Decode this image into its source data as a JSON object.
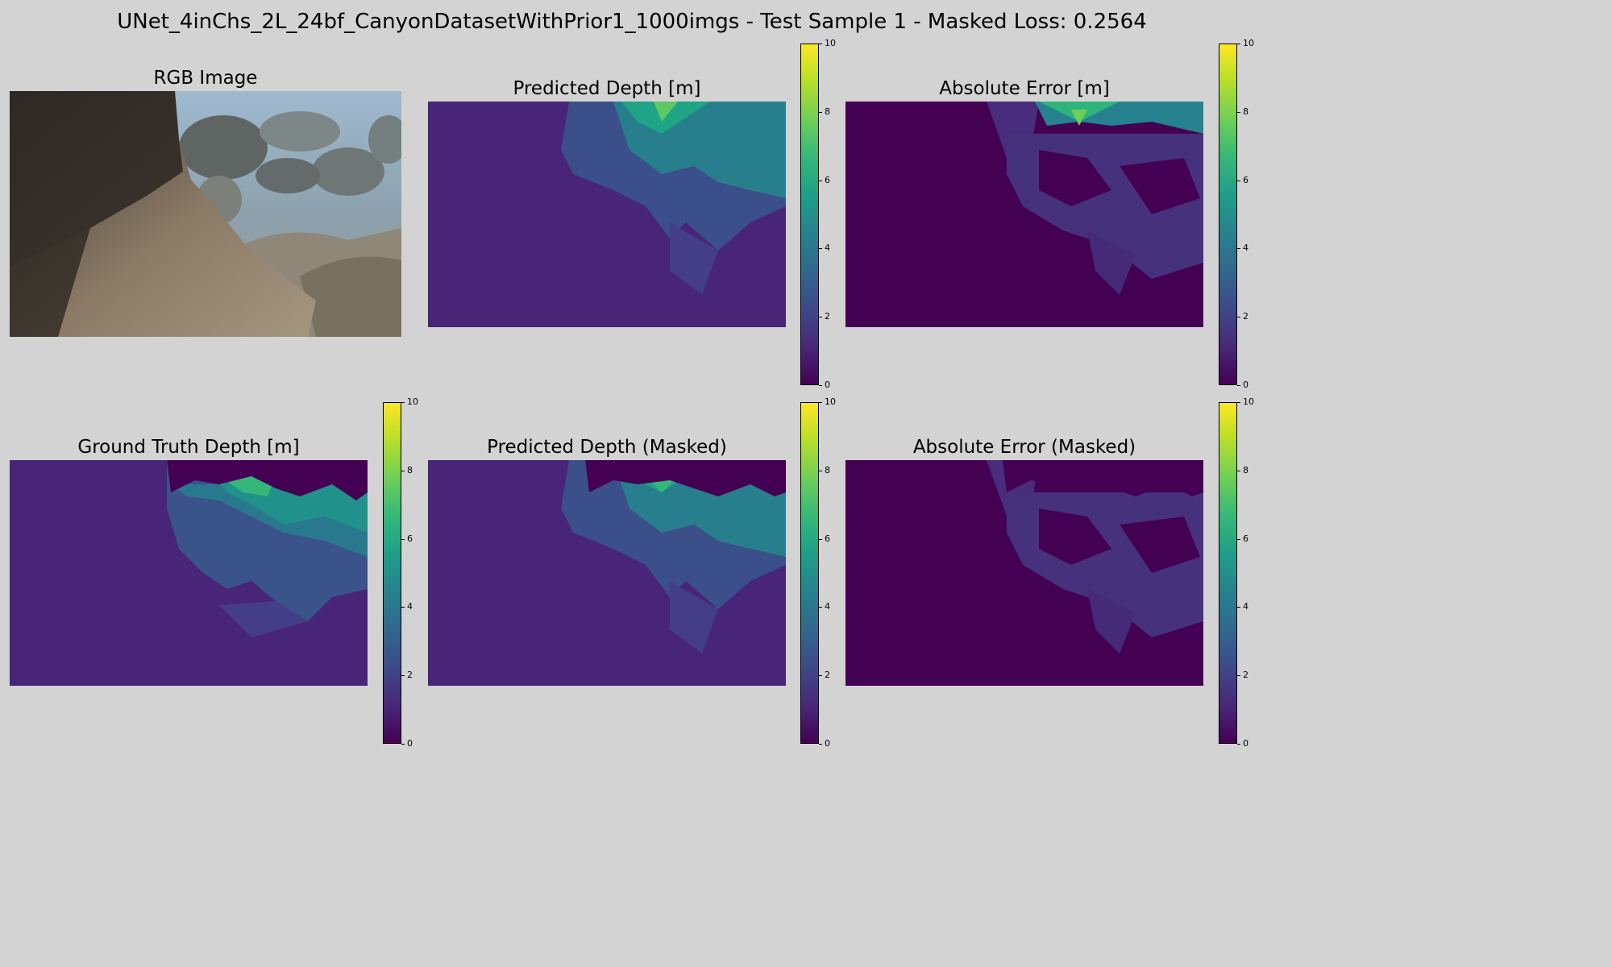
{
  "suptitle": "UNet_4inChs_2L_24bf_CanyonDatasetWithPrior1_1000imgs - Test Sample 1 - Masked Loss: 0.2564",
  "colors": {
    "background": "#d3d3d3",
    "viridis": [
      "#440154",
      "#482878",
      "#3e4989",
      "#31688e",
      "#26828e",
      "#1f9e89",
      "#35b779",
      "#6ece58",
      "#b5de2b",
      "#fde725"
    ],
    "mask_color": "#440154"
  },
  "panels": {
    "rgb": {
      "title": "RGB Image",
      "kind": "photo-underwater-canyon-rock"
    },
    "pred": {
      "title": "Predicted Depth [m]",
      "kind": "depth-map",
      "colormap": "viridis",
      "vmin": 0,
      "vmax": 10
    },
    "err": {
      "title": "Absolute Error [m]",
      "kind": "error-map",
      "colormap": "viridis",
      "vmin": 0,
      "vmax": 10
    },
    "gt": {
      "title": "Ground Truth Depth [m]",
      "kind": "depth-map",
      "colormap": "viridis",
      "vmin": 0,
      "vmax": 10
    },
    "pred_masked": {
      "title": "Predicted Depth (Masked)",
      "kind": "depth-map",
      "colormap": "viridis",
      "vmin": 0,
      "vmax": 10
    },
    "err_masked": {
      "title": "Absolute Error (Masked)",
      "kind": "error-map",
      "colormap": "viridis",
      "vmin": 0,
      "vmax": 10
    }
  },
  "colorbar_ticks": [
    "0",
    "2",
    "4",
    "6",
    "8",
    "10"
  ],
  "chart_data": [
    {
      "type": "heatmap",
      "title": "Predicted Depth [m]",
      "colormap": "viridis",
      "range": [
        0,
        10
      ],
      "ticks": [
        0,
        2,
        4,
        6,
        8,
        10
      ]
    },
    {
      "type": "heatmap",
      "title": "Absolute Error [m]",
      "colormap": "viridis",
      "range": [
        0,
        10
      ],
      "ticks": [
        0,
        2,
        4,
        6,
        8,
        10
      ]
    },
    {
      "type": "heatmap",
      "title": "Ground Truth Depth [m]",
      "colormap": "viridis",
      "range": [
        0,
        10
      ],
      "ticks": [
        0,
        2,
        4,
        6,
        8,
        10
      ]
    },
    {
      "type": "heatmap",
      "title": "Predicted Depth (Masked)",
      "colormap": "viridis",
      "range": [
        0,
        10
      ],
      "ticks": [
        0,
        2,
        4,
        6,
        8,
        10
      ]
    },
    {
      "type": "heatmap",
      "title": "Absolute Error (Masked)",
      "colormap": "viridis",
      "range": [
        0,
        10
      ],
      "ticks": [
        0,
        2,
        4,
        6,
        8,
        10
      ]
    }
  ]
}
